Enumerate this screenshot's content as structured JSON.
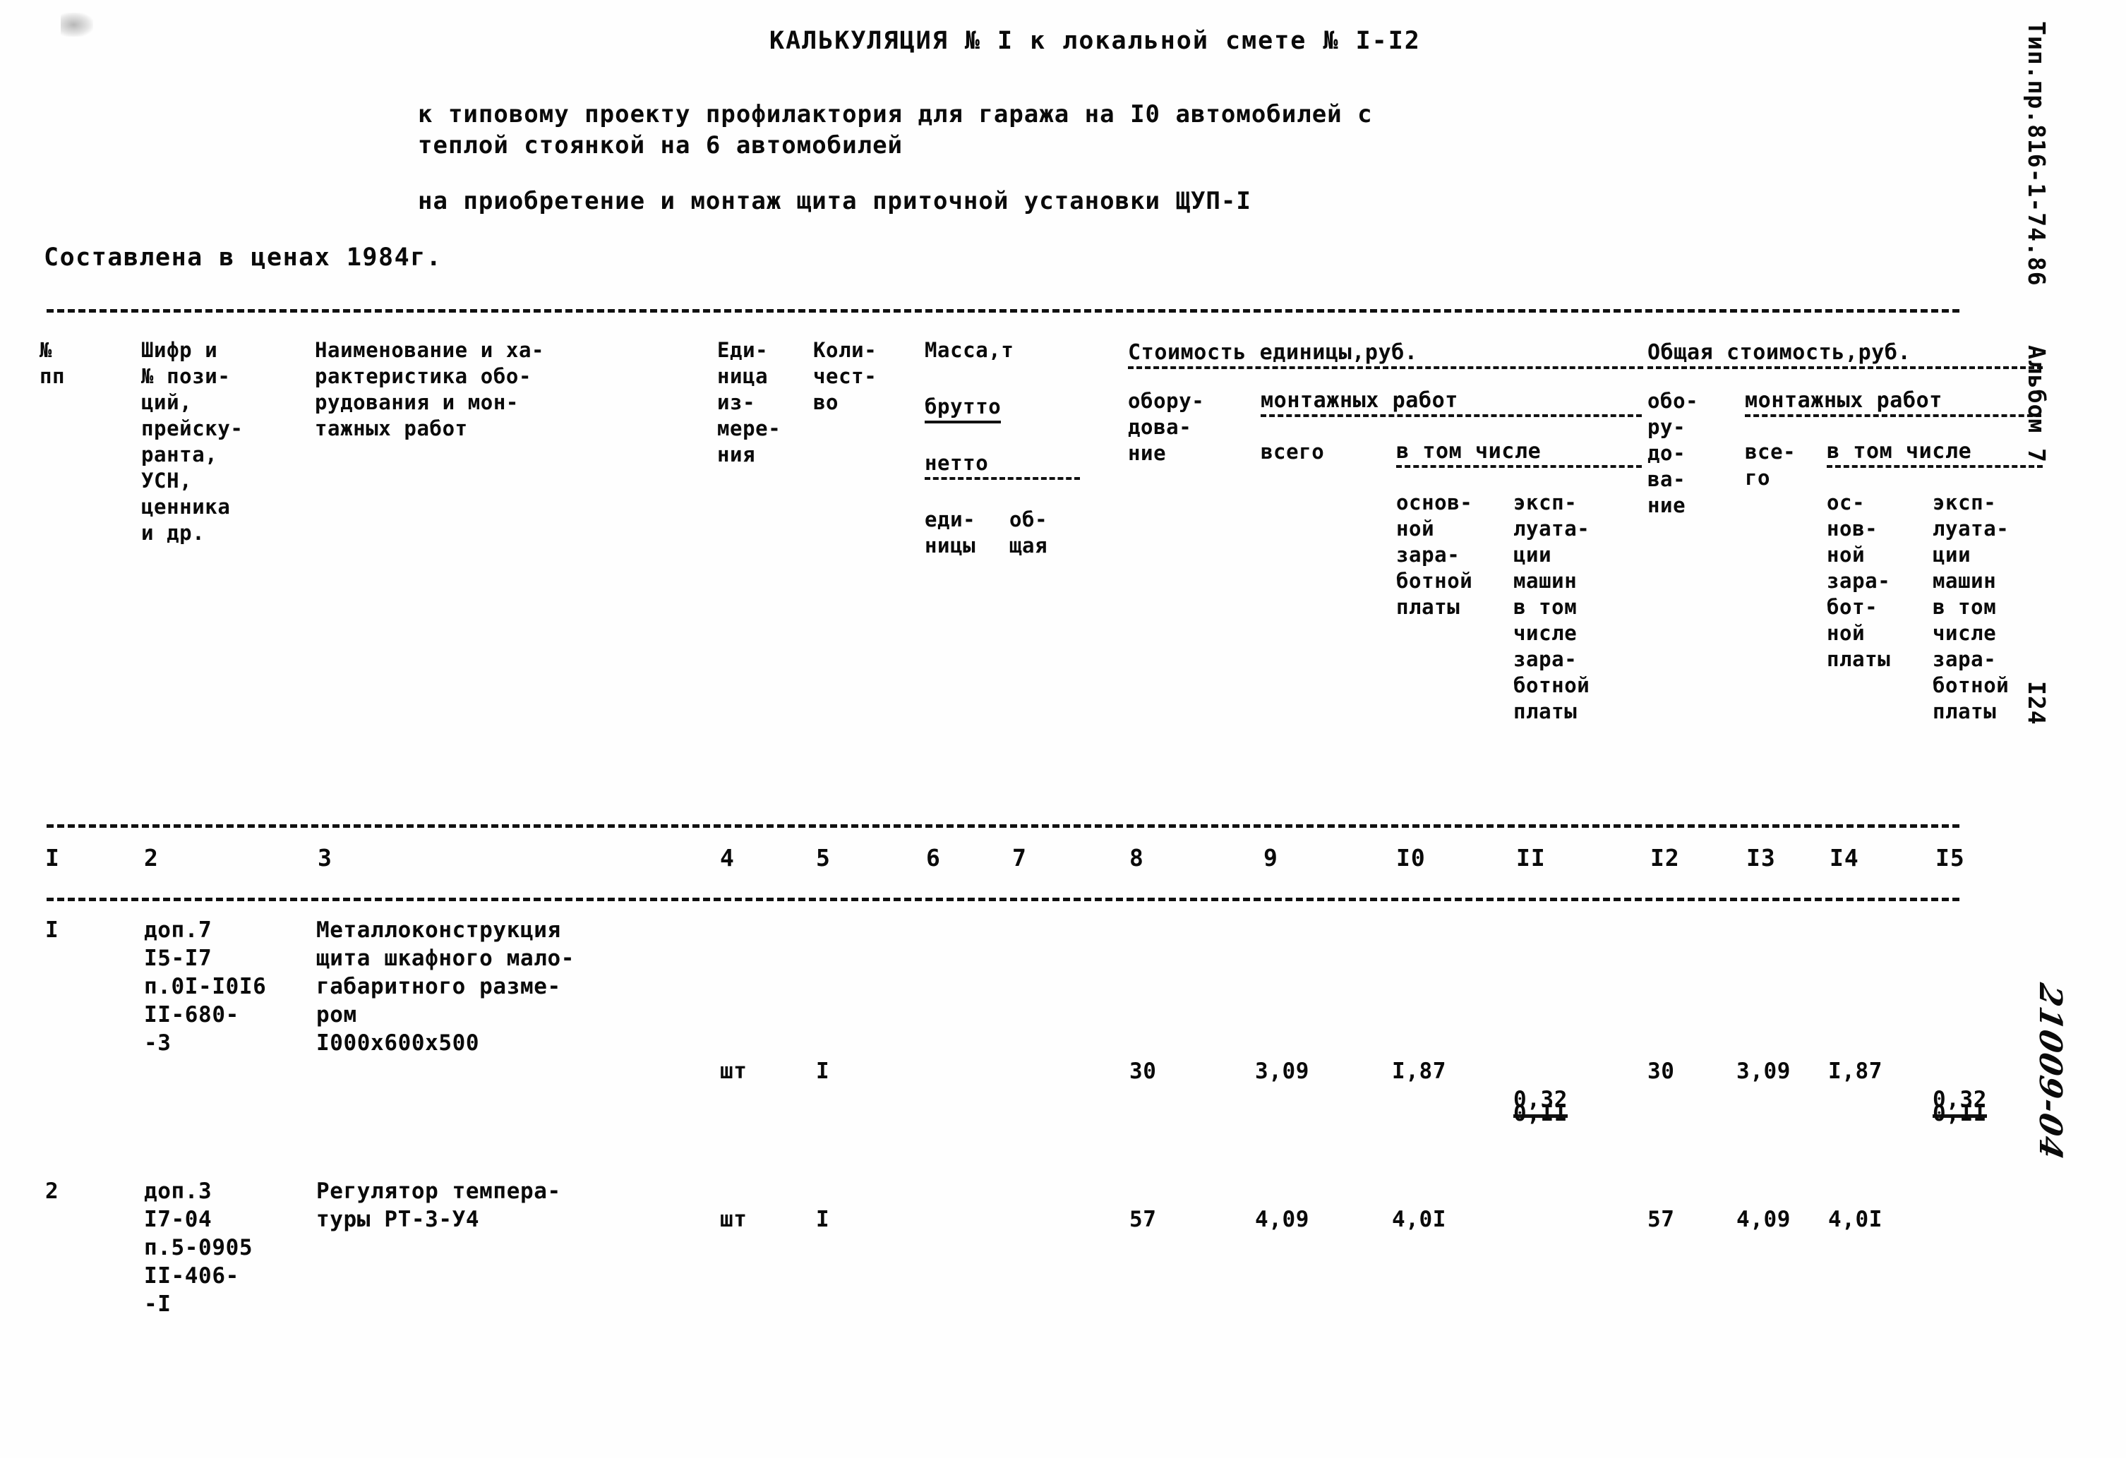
{
  "document": {
    "title": "КАЛЬКУЛЯЦИЯ № I к локальной смете № I-I2",
    "subtitle_line1": "к типовому проекту профилактория для гаража на I0 автомобилей с",
    "subtitle_line2": "теплой стоянкой на 6 автомобилей",
    "purpose": "на приобретение и монтаж щита приточной установки ЩУП-I",
    "price_basis": "Составлена в ценах 1984г.",
    "margin_stamp": "Тип.пр.816-1-74.86    Альбом 7",
    "margin_page": "I24",
    "margin_handwritten": "21009-04"
  },
  "table": {
    "headers": {
      "col1": "№\nпп",
      "col2": "Шифр и\n№ пози-\nций,\nпрейску-\nранта,\nУСН,\nценника\nи др.",
      "col3": "Наименование и ха-\nрактеристика обо-\nрудования и мон-\nтажных работ",
      "col4": "Еди-\nница\nиз-\nмере-\nния",
      "col5": "Коли-\nчест-\nво",
      "col6_group": "Масса,т",
      "col6_brutto": "брутто",
      "col6_netto": "нетто",
      "col6_unit": "еди-",
      "col6_unit2": "ницы",
      "col7_total": "об-",
      "col7_total2": "щая",
      "unit_cost_group": "Стоимость единицы,руб.",
      "unit_equipment": "обору-\nдова-\nние",
      "unit_install_group": "монтажных работ",
      "unit_install_total": "всего",
      "unit_install_incl": "в том числе",
      "unit_install_basic": "основ-\nной\nзара-\nботной\nплаты",
      "unit_install_machines": "эксп-\nлуата-\nции\nмашин\nв том\nчисле\nзара-\nботной\nплаты",
      "total_cost_group": "Общая стоимость,руб.",
      "total_equipment": "обо-\nру-\nдо-\nва-\nние",
      "total_install_group": "монтажных работ",
      "total_install_total": "все-\nго",
      "total_install_incl": "в том числе",
      "total_install_basic": "ос-\nнов-\nной\nзара-\nбот-\nной\nплаты",
      "total_install_machines": "эксп-\nлуата-\nции\nмашин\nв том\nчисле\nзара-\nботной\nплаты"
    },
    "column_numbers": [
      "I",
      "2",
      "3",
      "4",
      "5",
      "6",
      "7",
      "8",
      "9",
      "I0",
      "II",
      "I2",
      "I3",
      "I4",
      "I5"
    ],
    "rows": [
      {
        "no": "I",
        "code": "доп.7\nI5-I7\nп.0I-I0I6\nII-680-\n-3",
        "name": "Металлоконструкция\nщита шкафного мало-\nгабаритного разме-\nром\nI000x600x500",
        "unit": "шт",
        "qty": "I",
        "mass_brutto": "",
        "mass_netto": "",
        "unit_equipment": "30",
        "unit_install_total": "3,09",
        "unit_install_basic": "I,87",
        "unit_install_machines_top": "0,32",
        "unit_install_machines_bottom": "0,II",
        "total_equipment": "30",
        "total_install_total": "3,09",
        "total_install_basic": "I,87",
        "total_install_machines_top": "0,32",
        "total_install_machines_bottom": "0,II"
      },
      {
        "no": "2",
        "code": "доп.3\nI7-04\nп.5-0905\nII-406-\n-I",
        "name": "Регулятор темпера-\nтуры РТ-3-У4",
        "unit": "шт",
        "qty": "I",
        "mass_brutto": "",
        "mass_netto": "",
        "unit_equipment": "57",
        "unit_install_total": "4,09",
        "unit_install_basic": "4,0I",
        "unit_install_machines_top": "",
        "unit_install_machines_bottom": "",
        "total_equipment": "57",
        "total_install_total": "4,09",
        "total_install_basic": "4,0I",
        "total_install_machines_top": "",
        "total_install_machines_bottom": ""
      }
    ]
  }
}
